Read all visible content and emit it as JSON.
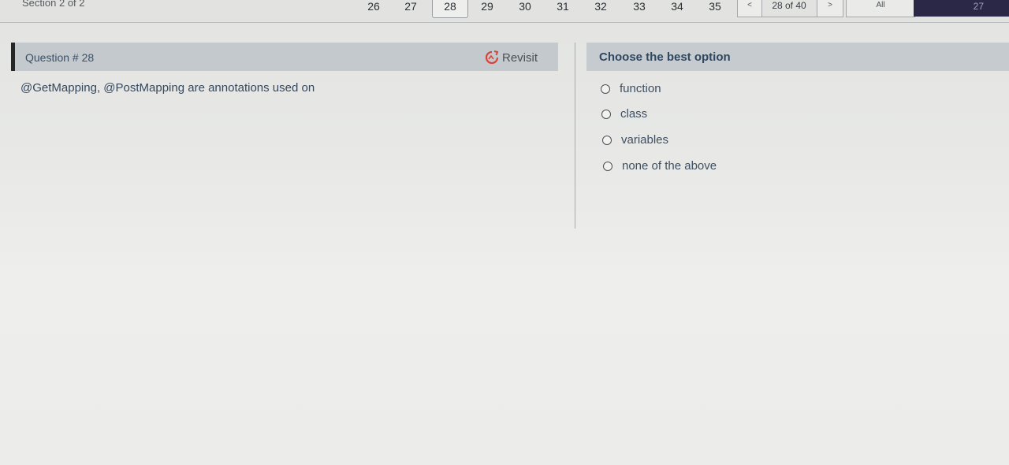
{
  "topbar": {
    "section_label": "Section 2 of 2",
    "question_numbers": [
      "26",
      "27",
      "28",
      "29",
      "30",
      "31",
      "32",
      "33",
      "34",
      "35"
    ],
    "active_question": "28",
    "prev_label": "<",
    "pager_status": "28 of 40",
    "next_label": ">",
    "all_label": "All",
    "timer_value": "27"
  },
  "question": {
    "title": "Question # 28",
    "revisit_label": "Revisit",
    "text": "@GetMapping, @PostMapping are annotations used on"
  },
  "options": {
    "title": "Choose the best option",
    "items": [
      "function",
      "class",
      "variables",
      "none of the above"
    ]
  },
  "colors": {
    "timer_bg": "#2b2747",
    "header_bg": "#c4c9cd",
    "text_blue": "#34485e",
    "revisit_icon": "#d9443a"
  }
}
